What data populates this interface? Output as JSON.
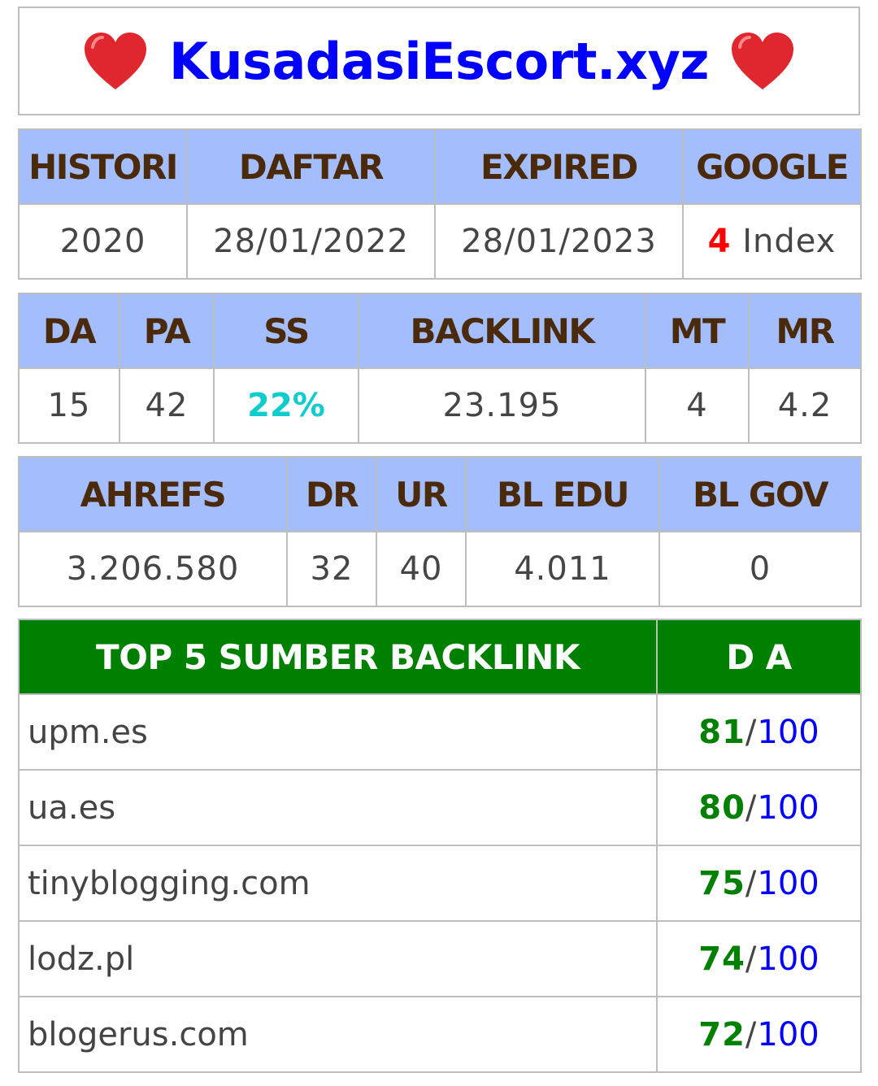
{
  "header": {
    "title": "KusadasiEscort.xyz"
  },
  "info": {
    "headers": [
      "HISTORI",
      "DAFTAR",
      "EXPIRED",
      "GOOGLE"
    ],
    "histori": "2020",
    "daftar": "28/01/2022",
    "expired": "28/01/2023",
    "google_count": "4",
    "google_label": "Index"
  },
  "moz": {
    "headers": [
      "DA",
      "PA",
      "SS",
      "BACKLINK",
      "MT",
      "MR"
    ],
    "values": [
      "15",
      "42",
      "22%",
      "23.195",
      "4",
      "4.2"
    ]
  },
  "ahrefs": {
    "headers": [
      "AHREFS",
      "DR",
      "UR",
      "BL EDU",
      "BL GOV"
    ],
    "values": [
      "3.206.580",
      "32",
      "40",
      "4.011",
      "0"
    ]
  },
  "backlinks": {
    "header_source": "TOP 5 SUMBER BACKLINK",
    "header_da": "D A",
    "max": "100",
    "rows": [
      {
        "site": "upm.es",
        "da": "81"
      },
      {
        "site": "ua.es",
        "da": "80"
      },
      {
        "site": "tinyblogging.com",
        "da": "75"
      },
      {
        "site": "lodz.pl",
        "da": "74"
      },
      {
        "site": "blogerus.com",
        "da": "72"
      }
    ]
  },
  "colors": {
    "header_bg": "#a4bdfc",
    "header_text": "#4a2a0a",
    "title": "#0000ff",
    "google_count": "#ff0000",
    "ss": "#10cccc",
    "backlink_header_bg": "#008000",
    "da_value": "#008000",
    "da_max": "#0000ff"
  },
  "icons": [
    "heart-icon",
    "heart-icon"
  ]
}
